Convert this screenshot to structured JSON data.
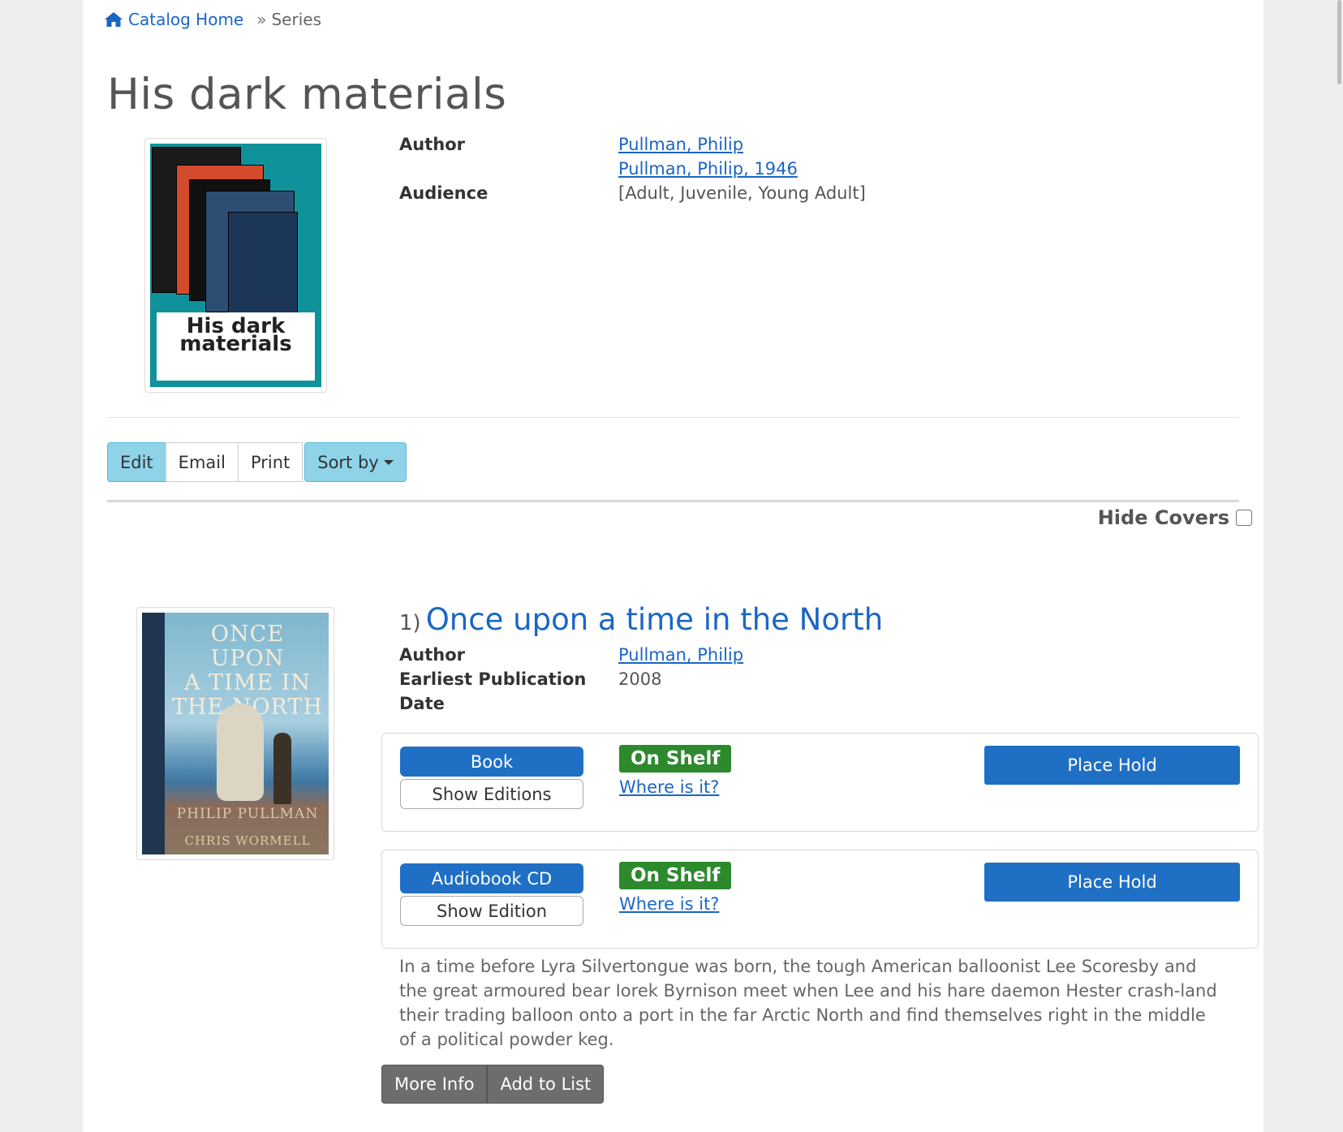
{
  "breadcrumb": {
    "home_label": "Catalog Home",
    "separator": "»",
    "current": "Series"
  },
  "title": "His dark materials",
  "series_cover": {
    "caption_line1": "His dark",
    "caption_line2": "materials"
  },
  "details": {
    "author_label": "Author",
    "authors": [
      "Pullman, Philip",
      "Pullman, Philip, 1946"
    ],
    "audience_label": "Audience",
    "audience_value": "[Adult, Juvenile, Young Adult]"
  },
  "toolbar": {
    "edit": "Edit",
    "email": "Email",
    "print": "Print",
    "sort": "Sort by"
  },
  "hide_covers_label": "Hide Covers",
  "item": {
    "number": "1)",
    "title": "Once upon a time in the North",
    "cover": {
      "title_lines": [
        "ONCE UPON",
        "A TIME IN",
        "THE NORTH"
      ],
      "author": "PHILIP PULLMAN",
      "illustrator": "CHRIS WORMELL"
    },
    "author_label": "Author",
    "author": "Pullman, Philip",
    "date_label_1": "Earliest Publication",
    "date_label_2": "Date",
    "date": "2008",
    "formats": [
      {
        "format": "Book",
        "editions": "Show Editions",
        "status": "On Shelf",
        "where": "Where is it?",
        "hold": "Place Hold"
      },
      {
        "format": "Audiobook CD",
        "editions": "Show Edition",
        "status": "On Shelf",
        "where": "Where is it?",
        "hold": "Place Hold"
      }
    ],
    "description": "In a time before Lyra Silvertongue was born, the tough American balloonist Lee Scoresby and the great armoured bear Iorek Byrnison meet when Lee and his hare daemon Hester crash-land their trading balloon onto a port in the far Arctic North and find themselves right in the middle of a political powder keg.",
    "more_info": "More Info",
    "add_to_list": "Add to List"
  },
  "colors": {
    "link": "#1b66c5",
    "primary_button": "#1f6fc5",
    "on_shelf": "#2c8a2c",
    "info_button": "#8fd3e8"
  },
  "icons": {
    "home": "home-icon",
    "caret": "caret-down-icon"
  }
}
